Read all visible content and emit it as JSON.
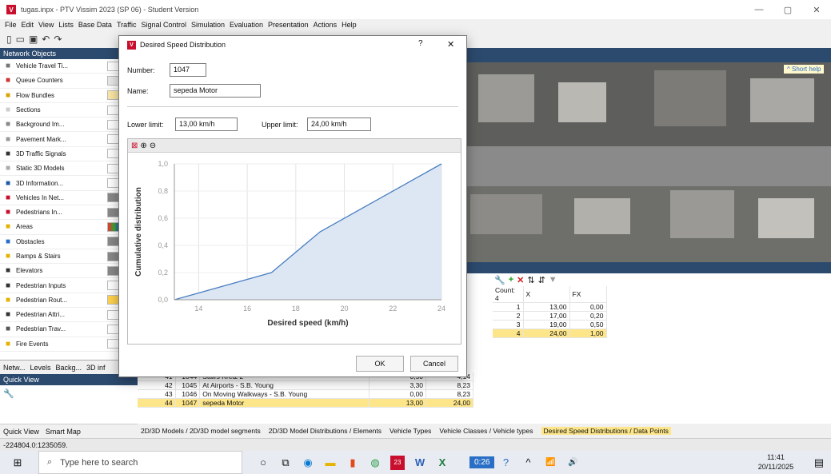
{
  "window": {
    "title": "tugas.inpx - PTV Vissim 2023 (SP 06) - Student Version"
  },
  "menu": [
    "File",
    "Edit",
    "View",
    "Lists",
    "Base Data",
    "Traffic",
    "Signal Control",
    "Simulation",
    "Evaluation",
    "Presentation",
    "Actions",
    "Help"
  ],
  "network_objects": {
    "header": "Network Objects",
    "items": [
      "Vehicle Travel Ti...",
      "Queue Counters",
      "Flow Bundles",
      "Sections",
      "Background Im...",
      "Pavement Mark...",
      "3D Traffic Signals",
      "Static 3D Models",
      "3D Information...",
      "Vehicles In Net...",
      "Pedestrians In...",
      "Areas",
      "Obstacles",
      "Ramps & Stairs",
      "Elevators",
      "Pedestrian Inputs",
      "Pedestrian Rout...",
      "Pedestrian Attri...",
      "Pedestrian Trav...",
      "Fire Events"
    ]
  },
  "left_tabs": [
    "Netw...",
    "Levels",
    "Backg...",
    "3D inf"
  ],
  "quick_view": {
    "header": "Quick View",
    "tabs": [
      "Quick View",
      "Smart Map"
    ]
  },
  "status": {
    "coordinates": "-224804.0:1235059."
  },
  "map": {
    "help": "^ Short help"
  },
  "dialog": {
    "title": "Desired Speed Distribution",
    "help_glyph": "?",
    "close_glyph": "✕",
    "number_label": "Number:",
    "number_value": "1047",
    "name_label": "Name:",
    "name_value": "sepeda Motor",
    "lower_label": "Lower limit:",
    "lower_value": "13,00 km/h",
    "upper_label": "Upper limit:",
    "upper_value": "24,00 km/h",
    "ok": "OK",
    "cancel": "Cancel"
  },
  "chart_data": {
    "type": "area",
    "xlabel": "Desired speed (km/h)",
    "ylabel": "Cumulative distribution",
    "xlim": [
      13,
      24
    ],
    "ylim": [
      0,
      1
    ],
    "x_ticks": [
      "14",
      "16",
      "18",
      "20",
      "22",
      "24"
    ],
    "y_ticks": [
      "0,0",
      "0,2",
      "0,4",
      "0,6",
      "0,8",
      "1,0"
    ],
    "x": [
      13,
      17,
      19,
      24
    ],
    "y": [
      0.0,
      0.2,
      0.5,
      1.0
    ],
    "grid": true,
    "color": "#4a7fc1",
    "fill": "#dde7f4"
  },
  "speed_list": {
    "rows": [
      [
        "41",
        "1044",
        "Stairs Kretz 2",
        "0,50",
        "4,14"
      ],
      [
        "42",
        "1045",
        "At Airports - S.B. Young",
        "3,30",
        "8,23"
      ],
      [
        "43",
        "1046",
        "On Moving Walkways - S.B. Young",
        "0,00",
        "8,23"
      ],
      [
        "44",
        "1047",
        "sepeda Motor",
        "13,00",
        "24,00"
      ]
    ]
  },
  "data_points": {
    "count_label": "Count: 4",
    "headers": [
      "X",
      "FX"
    ],
    "rows": [
      [
        "1",
        "13,00",
        "0,00"
      ],
      [
        "2",
        "17,00",
        "0,20"
      ],
      [
        "3",
        "19,00",
        "0,50"
      ],
      [
        "4",
        "24,00",
        "1,00"
      ]
    ]
  },
  "bottom_tabs": [
    "2D/3D Models / 2D/3D model segments",
    "2D/3D Model Distributions / Elements",
    "Vehicle Types",
    "Vehicle Classes / Vehicle types",
    "Desired Speed Distributions / Data Points"
  ],
  "taskbar": {
    "search_placeholder": "Type here to search",
    "timer": "0:26",
    "time": "11:41",
    "date": "20/11/2025",
    "badge": "23"
  }
}
